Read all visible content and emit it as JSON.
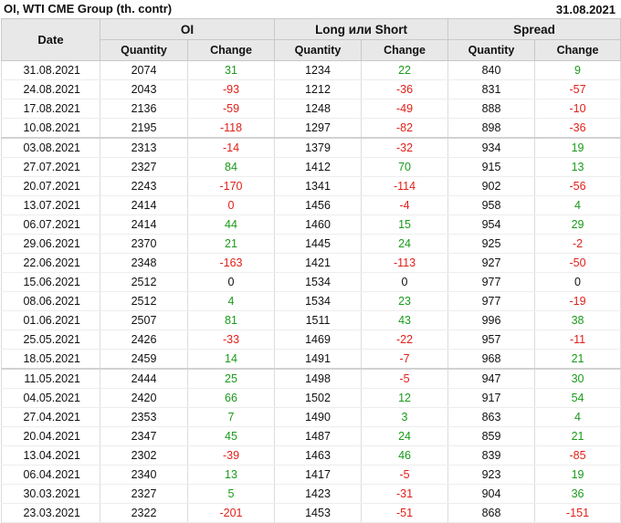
{
  "header": {
    "title": "OI, WTI CME Group (th. contr)",
    "date": "31.08.2021"
  },
  "columns": {
    "date": "Date",
    "groups": [
      "OI",
      "Long или Short",
      "Spread"
    ],
    "quantity": "Quantity",
    "change": "Change"
  },
  "colors": {
    "positive": "#1a9a1a",
    "negative": "#e0201a",
    "header_bg": "#e8e8e8"
  },
  "rows": [
    {
      "date": "31.08.2021",
      "oi_q": "2074",
      "oi_c": "31",
      "ls_q": "1234",
      "ls_c": "22",
      "sp_q": "840",
      "sp_c": "9"
    },
    {
      "date": "24.08.2021",
      "oi_q": "2043",
      "oi_c": "-93",
      "ls_q": "1212",
      "ls_c": "-36",
      "sp_q": "831",
      "sp_c": "-57"
    },
    {
      "date": "17.08.2021",
      "oi_q": "2136",
      "oi_c": "-59",
      "ls_q": "1248",
      "ls_c": "-49",
      "sp_q": "888",
      "sp_c": "-10"
    },
    {
      "date": "10.08.2021",
      "oi_q": "2195",
      "oi_c": "-118",
      "ls_q": "1297",
      "ls_c": "-82",
      "sp_q": "898",
      "sp_c": "-36"
    },
    {
      "date": "03.08.2021",
      "oi_q": "2313",
      "oi_c": "-14",
      "ls_q": "1379",
      "ls_c": "-32",
      "sp_q": "934",
      "sp_c": "19"
    },
    {
      "date": "27.07.2021",
      "oi_q": "2327",
      "oi_c": "84",
      "ls_q": "1412",
      "ls_c": "70",
      "sp_q": "915",
      "sp_c": "13"
    },
    {
      "date": "20.07.2021",
      "oi_q": "2243",
      "oi_c": "-170",
      "ls_q": "1341",
      "ls_c": "-114",
      "sp_q": "902",
      "sp_c": "-56"
    },
    {
      "date": "13.07.2021",
      "oi_q": "2414",
      "oi_c": "0",
      "ls_q": "1456",
      "ls_c": "-4",
      "sp_q": "958",
      "sp_c": "4"
    },
    {
      "date": "06.07.2021",
      "oi_q": "2414",
      "oi_c": "44",
      "ls_q": "1460",
      "ls_c": "15",
      "sp_q": "954",
      "sp_c": "29"
    },
    {
      "date": "29.06.2021",
      "oi_q": "2370",
      "oi_c": "21",
      "ls_q": "1445",
      "ls_c": "24",
      "sp_q": "925",
      "sp_c": "-2"
    },
    {
      "date": "22.06.2021",
      "oi_q": "2348",
      "oi_c": "-163",
      "ls_q": "1421",
      "ls_c": "-113",
      "sp_q": "927",
      "sp_c": "-50"
    },
    {
      "date": "15.06.2021",
      "oi_q": "2512",
      "oi_c": "0",
      "ls_q": "1534",
      "ls_c": "0",
      "sp_q": "977",
      "sp_c": "0"
    },
    {
      "date": "08.06.2021",
      "oi_q": "2512",
      "oi_c": "4",
      "ls_q": "1534",
      "ls_c": "23",
      "sp_q": "977",
      "sp_c": "-19"
    },
    {
      "date": "01.06.2021",
      "oi_q": "2507",
      "oi_c": "81",
      "ls_q": "1511",
      "ls_c": "43",
      "sp_q": "996",
      "sp_c": "38"
    },
    {
      "date": "25.05.2021",
      "oi_q": "2426",
      "oi_c": "-33",
      "ls_q": "1469",
      "ls_c": "-22",
      "sp_q": "957",
      "sp_c": "-11"
    },
    {
      "date": "18.05.2021",
      "oi_q": "2459",
      "oi_c": "14",
      "ls_q": "1491",
      "ls_c": "-7",
      "sp_q": "968",
      "sp_c": "21"
    },
    {
      "date": "11.05.2021",
      "oi_q": "2444",
      "oi_c": "25",
      "ls_q": "1498",
      "ls_c": "-5",
      "sp_q": "947",
      "sp_c": "30"
    },
    {
      "date": "04.05.2021",
      "oi_q": "2420",
      "oi_c": "66",
      "ls_q": "1502",
      "ls_c": "12",
      "sp_q": "917",
      "sp_c": "54"
    },
    {
      "date": "27.04.2021",
      "oi_q": "2353",
      "oi_c": "7",
      "ls_q": "1490",
      "ls_c": "3",
      "sp_q": "863",
      "sp_c": "4"
    },
    {
      "date": "20.04.2021",
      "oi_q": "2347",
      "oi_c": "45",
      "ls_q": "1487",
      "ls_c": "24",
      "sp_q": "859",
      "sp_c": "21"
    },
    {
      "date": "13.04.2021",
      "oi_q": "2302",
      "oi_c": "-39",
      "ls_q": "1463",
      "ls_c": "46",
      "sp_q": "839",
      "sp_c": "-85"
    },
    {
      "date": "06.04.2021",
      "oi_q": "2340",
      "oi_c": "13",
      "ls_q": "1417",
      "ls_c": "-5",
      "sp_q": "923",
      "sp_c": "19"
    },
    {
      "date": "30.03.2021",
      "oi_q": "2327",
      "oi_c": "5",
      "ls_q": "1423",
      "ls_c": "-31",
      "sp_q": "904",
      "sp_c": "36"
    },
    {
      "date": "23.03.2021",
      "oi_q": "2322",
      "oi_c": "-201",
      "ls_q": "1453",
      "ls_c": "-51",
      "sp_q": "868",
      "sp_c": "-151"
    }
  ]
}
